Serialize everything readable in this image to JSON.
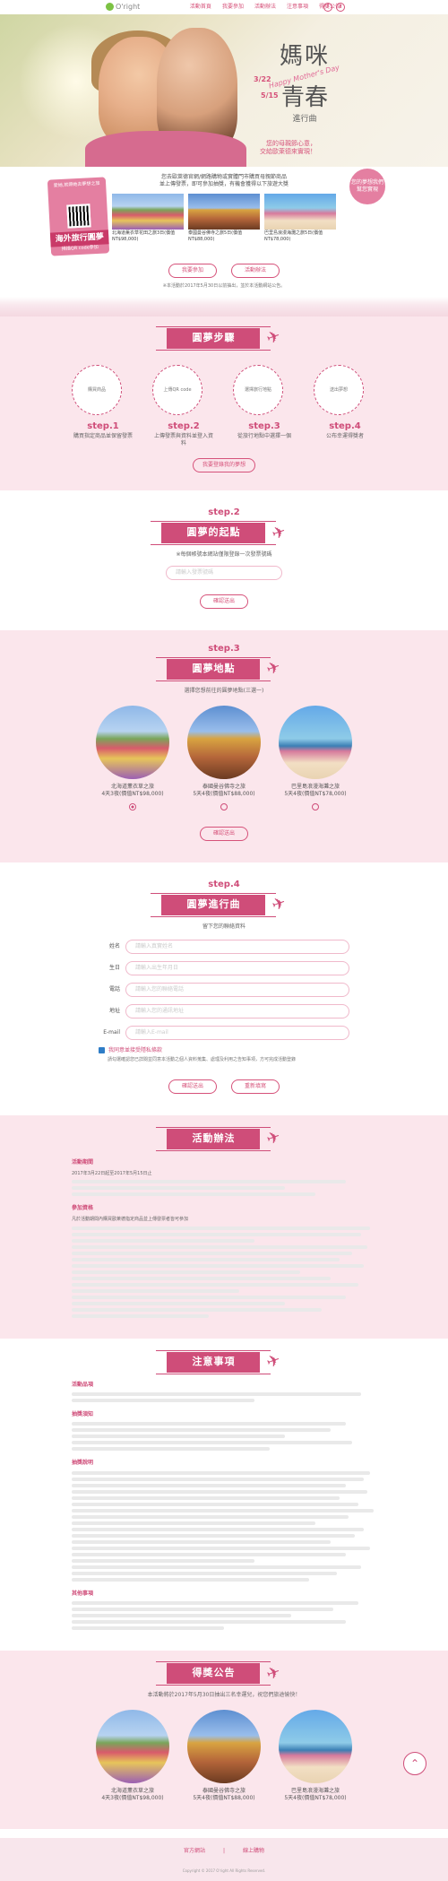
{
  "nav": {
    "logo": "O'right",
    "links": [
      "活動首頁",
      "我要參加",
      "活動辦法",
      "注意事項",
      "得獎公告"
    ],
    "icons": [
      "f",
      "⬆"
    ]
  },
  "hero": {
    "title1": "媽咪",
    "english": "Happy Mother's Day",
    "title2": "青春",
    "subtitle": "進行曲",
    "date_start": "3/22",
    "date_end": "5/15",
    "tagline1": "您的母親節心意，",
    "tagline2": "交給歐萊德來實現！"
  },
  "promo": {
    "card_top": "愛她,就帶她去夢想之旅",
    "card_big": "海外旅行圓夢",
    "card_bottom": "掃描QR code參加",
    "text1": "您去歐萊德官網/網路購物或實體門市購買母親節商品",
    "text2": "並上傳發票，即可參加抽獎，有機會獲得以下旅遊大獎",
    "stamp": "您的夢想我們幫您實現",
    "photos": [
      {
        "caption": "北海道薰衣草花田之旅3日(價值NT$98,000)"
      },
      {
        "caption": "泰國曼谷佛寺之旅5日(價值NT$88,000)"
      },
      {
        "caption": "巴里島浪漫海灘之旅5日(價值NT$78,000)"
      }
    ],
    "btn_join": "我要參加",
    "btn_rules": "活動辦法",
    "note": "※本活動於2017年5月30日以前抽出，並於本活動網站公告。"
  },
  "steps": {
    "title": "圓夢步驟",
    "items": [
      {
        "icon_text": "購買商品",
        "num": "step.1",
        "text": "購買指定商品並保留發票"
      },
      {
        "icon_text": "上傳QR code",
        "num": "step.2",
        "text": "上傳發票與資料並登入資料"
      },
      {
        "icon_text": "選擇旅行地點",
        "num": "step.3",
        "text": "從旅行地點中選擇一個"
      },
      {
        "icon_text": "送出夢想",
        "num": "step.4",
        "text": "公布幸運得獎者"
      }
    ],
    "btn": "我要登錄我的夢想"
  },
  "step2": {
    "num": "step.2",
    "title": "圓夢的起點",
    "desc": "※每個帳號本網站僅限登錄一次發票號碼",
    "placeholder": "請輸入發票號碼",
    "btn": "確認送出"
  },
  "step3": {
    "num": "step.3",
    "title": "圓夢地點",
    "desc": "選擇您想前往的圓夢地點(三選一)",
    "dests": [
      {
        "name": "北海道薰衣草之旅",
        "price": "4天3夜(價值NT$98,000)"
      },
      {
        "name": "泰國曼谷佛寺之旅",
        "price": "5天4夜(價值NT$88,000)"
      },
      {
        "name": "巴里島浪漫海灘之旅",
        "price": "5天4夜(價值NT$78,000)"
      }
    ],
    "btn": "確認送出"
  },
  "step4": {
    "num": "step.4",
    "title": "圓夢進行曲",
    "desc": "留下您的聯絡資料",
    "fields": [
      {
        "label": "姓名",
        "placeholder": "請輸入真實姓名"
      },
      {
        "label": "生日",
        "placeholder": "請輸入出生年月日"
      },
      {
        "label": "電話",
        "placeholder": "請輸入您的聯絡電話"
      },
      {
        "label": "地址",
        "placeholder": "請輸入您的通訊地址"
      },
      {
        "label": "E-mail",
        "placeholder": "請輸入E-mail"
      }
    ],
    "agree": "我同意並接受隱私條款",
    "agree_detail": "請勾選確認您已詳閱並同意本活動之個人資料蒐集、處理及利用之告知事項，方可完成活動登錄",
    "btn_confirm": "確認送出",
    "btn_reset": "重新填寫"
  },
  "rules": {
    "title": "活動辦法",
    "sections": [
      {
        "heading": "活動期間",
        "lines": [
          "2017年3月22日起至2017年5月15日止"
        ]
      },
      {
        "heading": "參加資格",
        "lines": [
          "凡於活動期間內購買歐萊德指定商品並上傳發票者皆可參加"
        ]
      }
    ]
  },
  "notice": {
    "title": "注意事項",
    "headings": [
      "活動品項",
      "抽獎須知",
      "抽獎說明",
      "其他事項"
    ]
  },
  "winners": {
    "title": "得獎公告",
    "desc": "本活動將於2017年5月30日抽出三名幸運兒，祝您們旅途愉快！",
    "items": [
      {
        "name": "北海道薰衣草之旅",
        "price": "4天3夜(價值NT$98,000)"
      },
      {
        "name": "泰國曼谷佛寺之旅",
        "price": "5天4夜(價值NT$88,000)"
      },
      {
        "name": "巴里島浪漫海灘之旅",
        "price": "5天4夜(價值NT$78,000)"
      }
    ]
  },
  "footer": {
    "link1": "官方網站",
    "link2": "線上購物",
    "copyright": "Copyright © 2017 O'right All Rights Reserved."
  }
}
